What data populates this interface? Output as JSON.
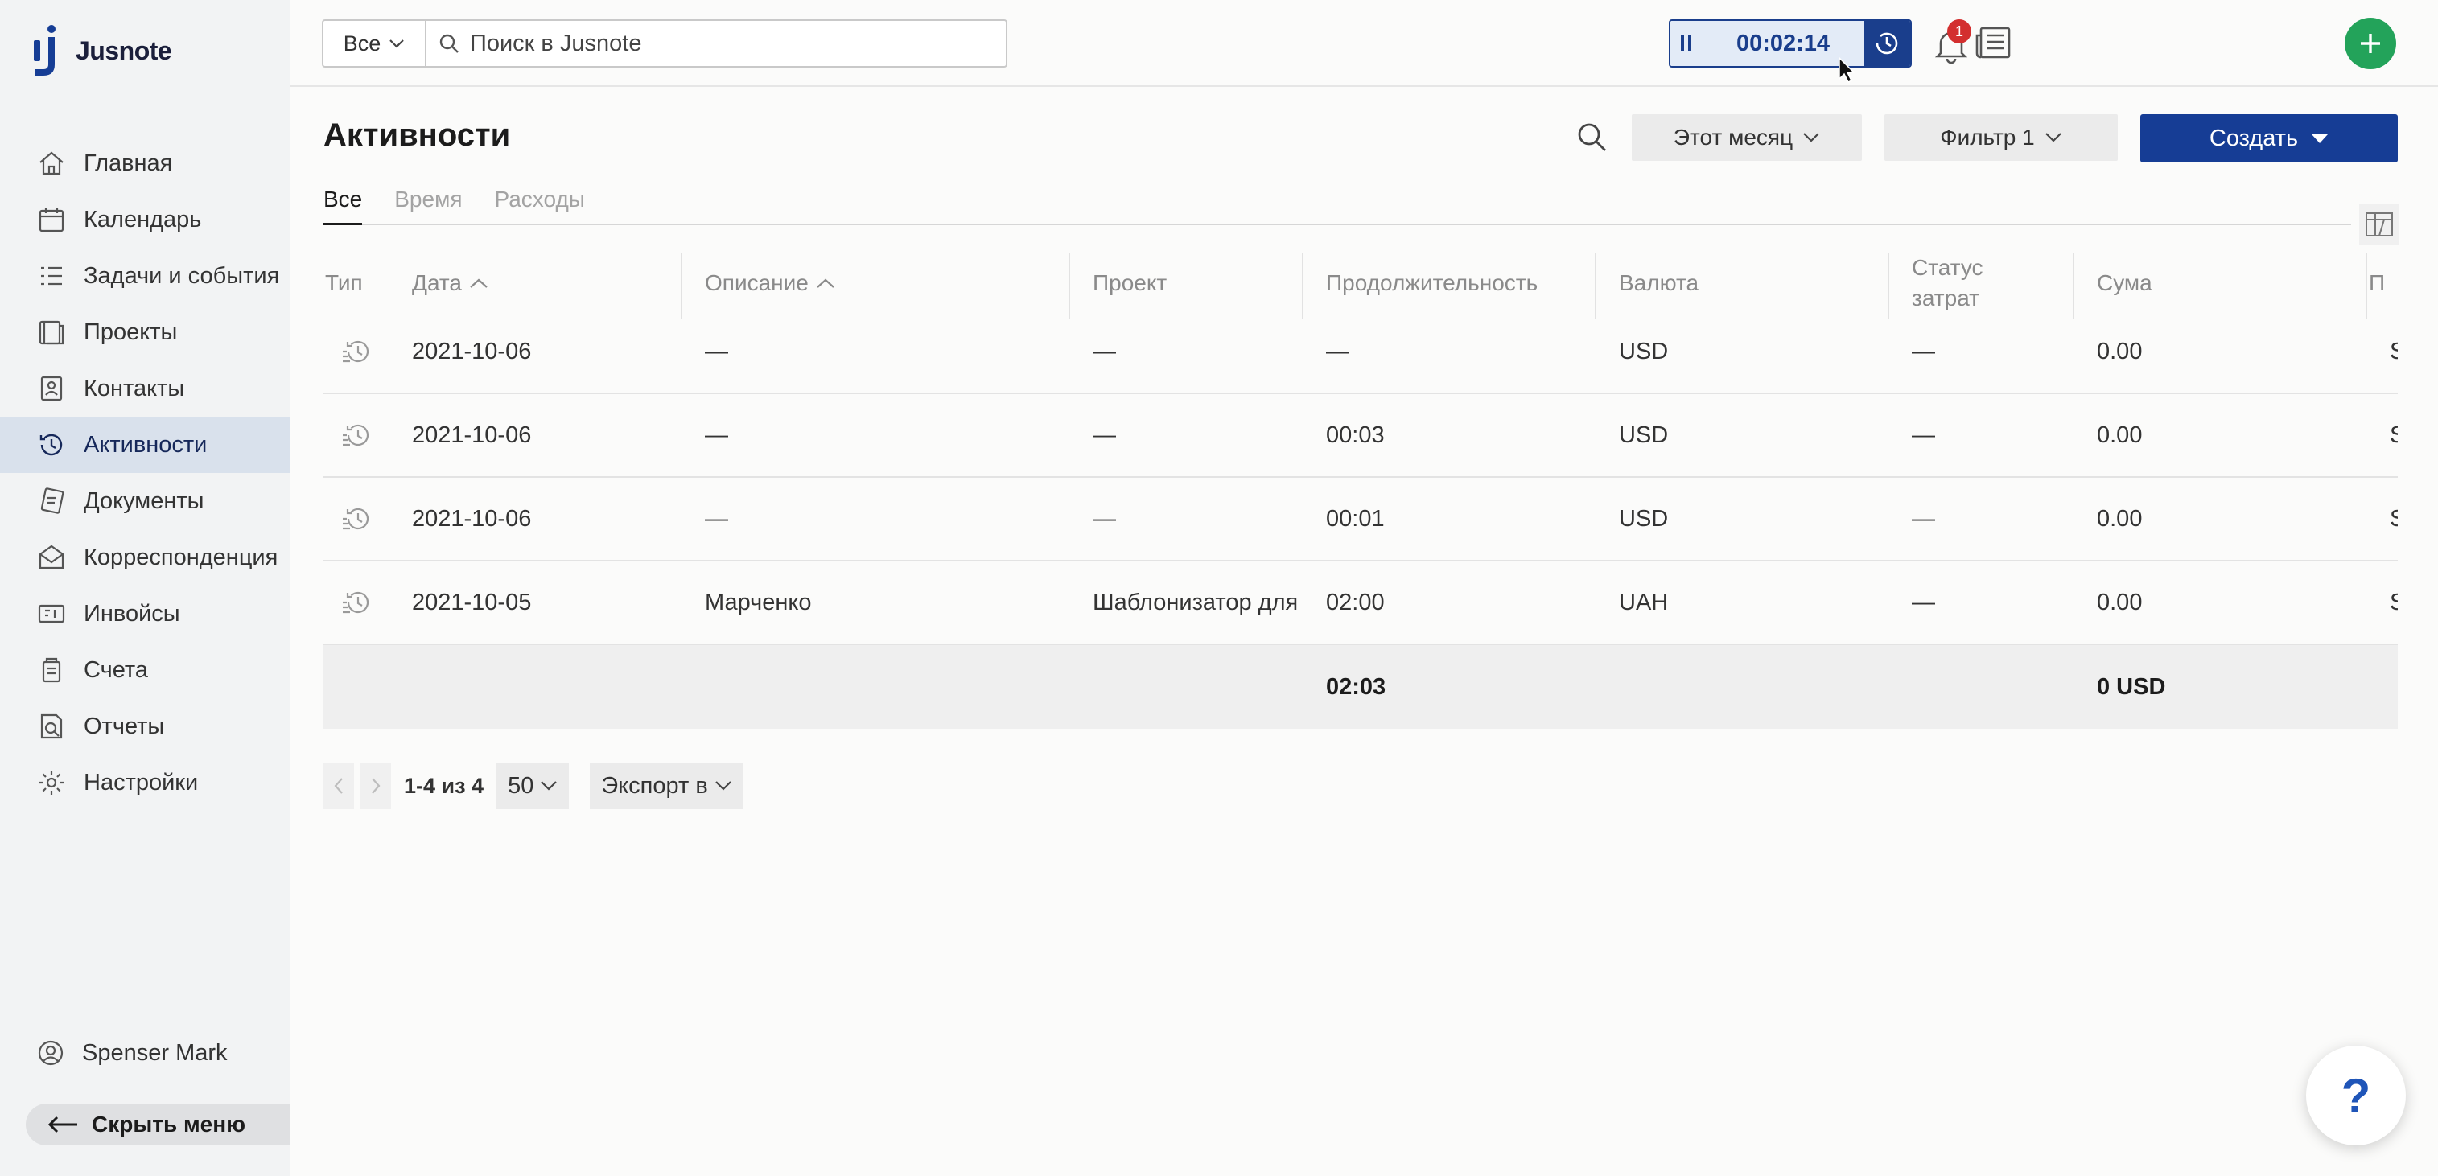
{
  "app": {
    "name": "Jusnote"
  },
  "sidebar": {
    "items": [
      {
        "label": "Главная",
        "icon": "home-icon"
      },
      {
        "label": "Календарь",
        "icon": "calendar-icon"
      },
      {
        "label": "Задачи и события",
        "icon": "tasks-icon"
      },
      {
        "label": "Проекты",
        "icon": "folder-icon"
      },
      {
        "label": "Контакты",
        "icon": "contacts-icon"
      },
      {
        "label": "Активности",
        "icon": "activity-history-icon",
        "active": true
      },
      {
        "label": "Документы",
        "icon": "documents-icon"
      },
      {
        "label": "Корреспонденция",
        "icon": "mail-icon"
      },
      {
        "label": "Инвойсы",
        "icon": "invoice-icon"
      },
      {
        "label": "Счета",
        "icon": "accounts-icon"
      },
      {
        "label": "Отчеты",
        "icon": "reports-icon"
      },
      {
        "label": "Настройки",
        "icon": "gear-icon"
      }
    ],
    "user": "Spenser Mark",
    "hide_menu": "Скрыть меню"
  },
  "topbar": {
    "scope": "Все",
    "search_placeholder": "Поиск в Jusnote",
    "timer": "00:02:14",
    "notifications": "1"
  },
  "header": {
    "title": "Активности",
    "period": "Этот месяц",
    "filter": "Фильтр 1",
    "create": "Создать"
  },
  "tabs": [
    "Все",
    "Время",
    "Расходы"
  ],
  "table": {
    "columns": [
      "Тип",
      "Дата",
      "Описание",
      "Проект",
      "Продолжительность",
      "Валюта",
      "Статус\nзатрат",
      "Сума",
      "П"
    ],
    "rows": [
      {
        "date": "2021-10-06",
        "description": "—",
        "project": "—",
        "duration": "—",
        "currency": "USD",
        "status": "—",
        "sum": "0.00",
        "extra": "S"
      },
      {
        "date": "2021-10-06",
        "description": "—",
        "project": "—",
        "duration": "00:03",
        "currency": "USD",
        "status": "—",
        "sum": "0.00",
        "extra": "S"
      },
      {
        "date": "2021-10-06",
        "description": "—",
        "project": "—",
        "duration": "00:01",
        "currency": "USD",
        "status": "—",
        "sum": "0.00",
        "extra": "S"
      },
      {
        "date": "2021-10-05",
        "description": "Марченко",
        "project": "Шаблонизатор для",
        "duration": "02:00",
        "currency": "UAH",
        "status": "—",
        "sum": "0.00",
        "extra": "S"
      }
    ],
    "totals": {
      "duration": "02:03",
      "sum": "0 USD"
    }
  },
  "pager": {
    "range": "1-4 из 4",
    "page_size": "50",
    "export": "Экспорт в"
  },
  "help": "?",
  "colors": {
    "accent": "#163d95",
    "add": "#23a35a",
    "badge": "#d32f2f",
    "active_nav": "#d9e1ec"
  }
}
